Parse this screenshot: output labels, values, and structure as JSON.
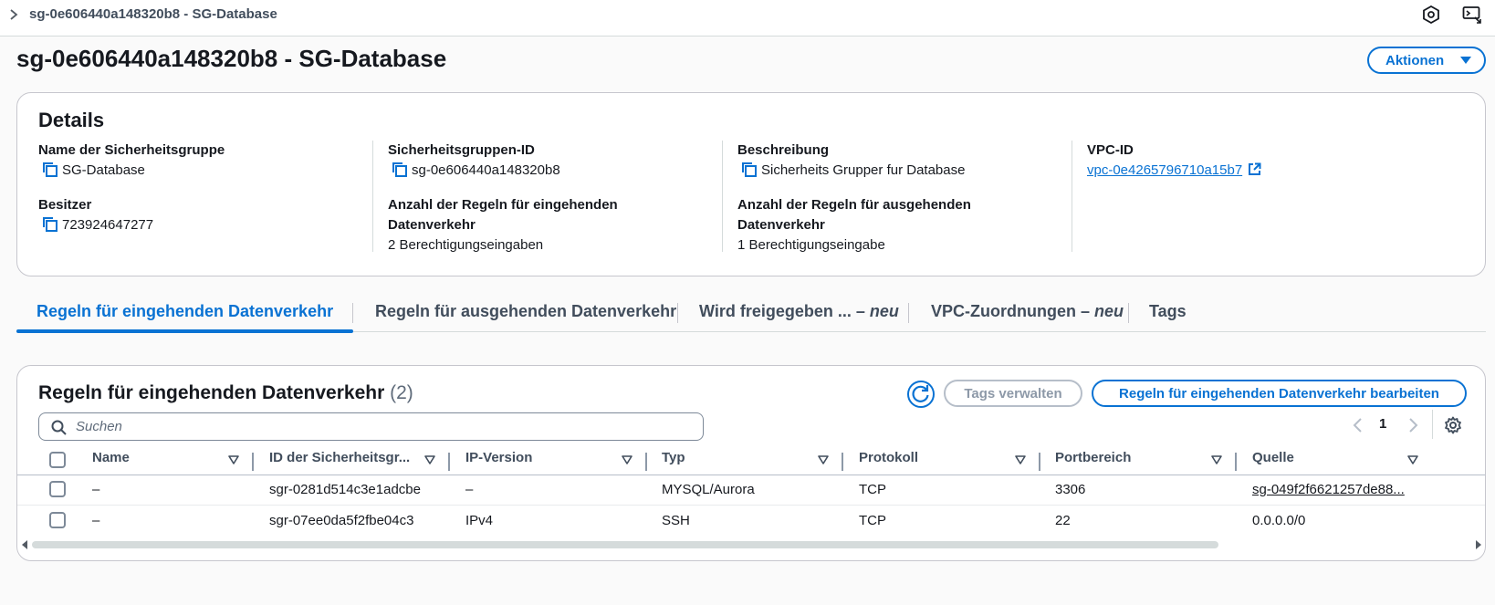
{
  "breadcrumb": {
    "current": "sg-0e606440a148320b8 - SG-Database"
  },
  "header": {
    "title": "sg-0e606440a148320b8 - SG-Database",
    "actions_label": "Aktionen"
  },
  "details": {
    "heading": "Details",
    "fields": {
      "name": {
        "label": "Name der Sicherheitsgruppe",
        "value": "SG-Database"
      },
      "id": {
        "label": "Sicherheitsgruppen-ID",
        "value": "sg-0e606440a148320b8"
      },
      "description": {
        "label": "Beschreibung",
        "value": "Sicherheits Grupper fur Database"
      },
      "vpc": {
        "label": "VPC-ID",
        "value": "vpc-0e4265796710a15b7"
      },
      "owner": {
        "label": "Besitzer",
        "value": "723924647277"
      },
      "inbound_count": {
        "label": "Anzahl der Regeln für eingehenden Datenverkehr",
        "value": "2 Berechtigungseingaben"
      },
      "outbound_count": {
        "label": "Anzahl der Regeln für ausgehenden Datenverkehr",
        "value": "1 Berechtigungseingabe"
      }
    }
  },
  "tabs": [
    {
      "label": "Regeln für eingehenden Datenverkehr",
      "suffix": ""
    },
    {
      "label": "Regeln für ausgehenden Datenverkehr",
      "suffix": ""
    },
    {
      "label": "Wird freigegeben ... – ",
      "suffix": "neu"
    },
    {
      "label": "VPC-Zuordnungen – ",
      "suffix": "neu"
    },
    {
      "label": "Tags",
      "suffix": ""
    }
  ],
  "rules": {
    "title": "Regeln für eingehenden Datenverkehr",
    "count": "(2)",
    "tags_button": "Tags verwalten",
    "edit_button": "Regeln für eingehenden Datenverkehr bearbeiten",
    "search_placeholder": "Suchen",
    "page": "1",
    "columns": [
      "Name",
      "ID der Sicherheitsgr...",
      "IP-Version",
      "Typ",
      "Protokoll",
      "Portbereich",
      "Quelle"
    ],
    "rows": [
      {
        "name": "–",
        "id": "sgr-0281d514c3e1adcbe",
        "ip": "–",
        "type": "MYSQL/Aurora",
        "protocol": "TCP",
        "port": "3306",
        "source": "sg-049f2f6621257de88..."
      },
      {
        "name": "–",
        "id": "sgr-07ee0da5f2fbe04c3",
        "ip": "IPv4",
        "type": "SSH",
        "protocol": "TCP",
        "port": "22",
        "source": "0.0.0.0/0"
      }
    ]
  },
  "colors": {
    "accent": "#0972d3",
    "text": "#16191f",
    "muted": "#414d5c",
    "border": "#c6c6cd"
  }
}
